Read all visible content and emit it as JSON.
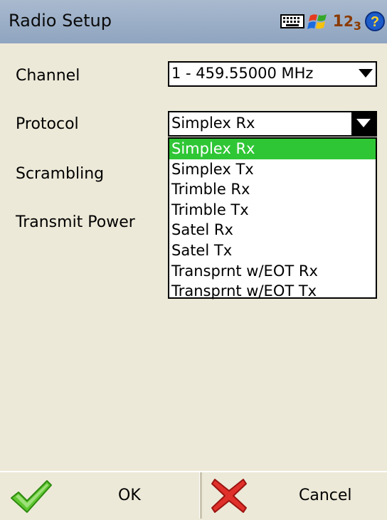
{
  "window": {
    "title": "Radio Setup"
  },
  "tray": {
    "numbers_big": "1",
    "numbers_mid": "2",
    "numbers_small": "3"
  },
  "form": {
    "channel": {
      "label": "Channel",
      "value": "1 - 459.55000 MHz"
    },
    "protocol": {
      "label": "Protocol",
      "value": "Simplex Rx",
      "options": [
        "Simplex Rx",
        "Simplex Tx",
        "Trimble Rx",
        "Trimble Tx",
        "Satel Rx",
        "Satel Tx",
        "Transprnt w/EOT Rx",
        "Transprnt w/EOT Tx"
      ]
    },
    "scrambling": {
      "label": "Scrambling"
    },
    "transmit_power": {
      "label": "Transmit Power"
    }
  },
  "buttons": {
    "ok": "OK",
    "cancel": "Cancel"
  },
  "colors": {
    "titlebar": "#9aaec8",
    "selection": "#2fc636",
    "background": "#ece9d8"
  }
}
